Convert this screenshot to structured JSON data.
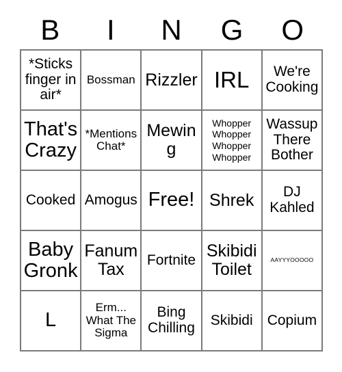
{
  "card": {
    "title": "BINGO",
    "header": {
      "letters": [
        "B",
        "I",
        "N",
        "G",
        "O"
      ]
    },
    "colors": {
      "background": "#ffffff",
      "text": "#000000",
      "grid_line": "#7a7a7a"
    },
    "grid": {
      "columns": 5,
      "rows": 5,
      "free_space": {
        "label": "Free!",
        "row": 3,
        "column": 3
      },
      "cells": [
        {
          "text": "*Sticks finger in air*",
          "size": "md"
        },
        {
          "text": "Bossman",
          "size": "sm"
        },
        {
          "text": "Rizzler",
          "size": "lg"
        },
        {
          "text": "IRL",
          "size": "xxl"
        },
        {
          "text": "We're Cooking",
          "size": "md"
        },
        {
          "text": "That's Crazy",
          "size": "xl"
        },
        {
          "text": "*Mentions Chat*",
          "size": "sm"
        },
        {
          "text": "Mewing",
          "size": "lg"
        },
        {
          "text": "Whopper Whopper Whopper Whopper",
          "size": "xs"
        },
        {
          "text": "Wassup There Bother",
          "size": "md"
        },
        {
          "text": "Cooked",
          "size": "md"
        },
        {
          "text": "Amogus",
          "size": "md"
        },
        {
          "text": "Free!",
          "size": "xl"
        },
        {
          "text": "Shrek",
          "size": "lg"
        },
        {
          "text": "DJ Kahled",
          "size": "md"
        },
        {
          "text": "Baby Gronk",
          "size": "xl"
        },
        {
          "text": "Fanum Tax",
          "size": "lg"
        },
        {
          "text": "Fortnite",
          "size": "md"
        },
        {
          "text": "Skibidi Toilet",
          "size": "lg"
        },
        {
          "text": "AAYYYOOOOO",
          "size": "xxs"
        },
        {
          "text": "L",
          "size": "xl"
        },
        {
          "text": "Erm... What The Sigma",
          "size": "sm"
        },
        {
          "text": "Bing Chilling",
          "size": "md"
        },
        {
          "text": "Skibidi",
          "size": "md"
        },
        {
          "text": "Copium",
          "size": "md"
        }
      ]
    }
  }
}
